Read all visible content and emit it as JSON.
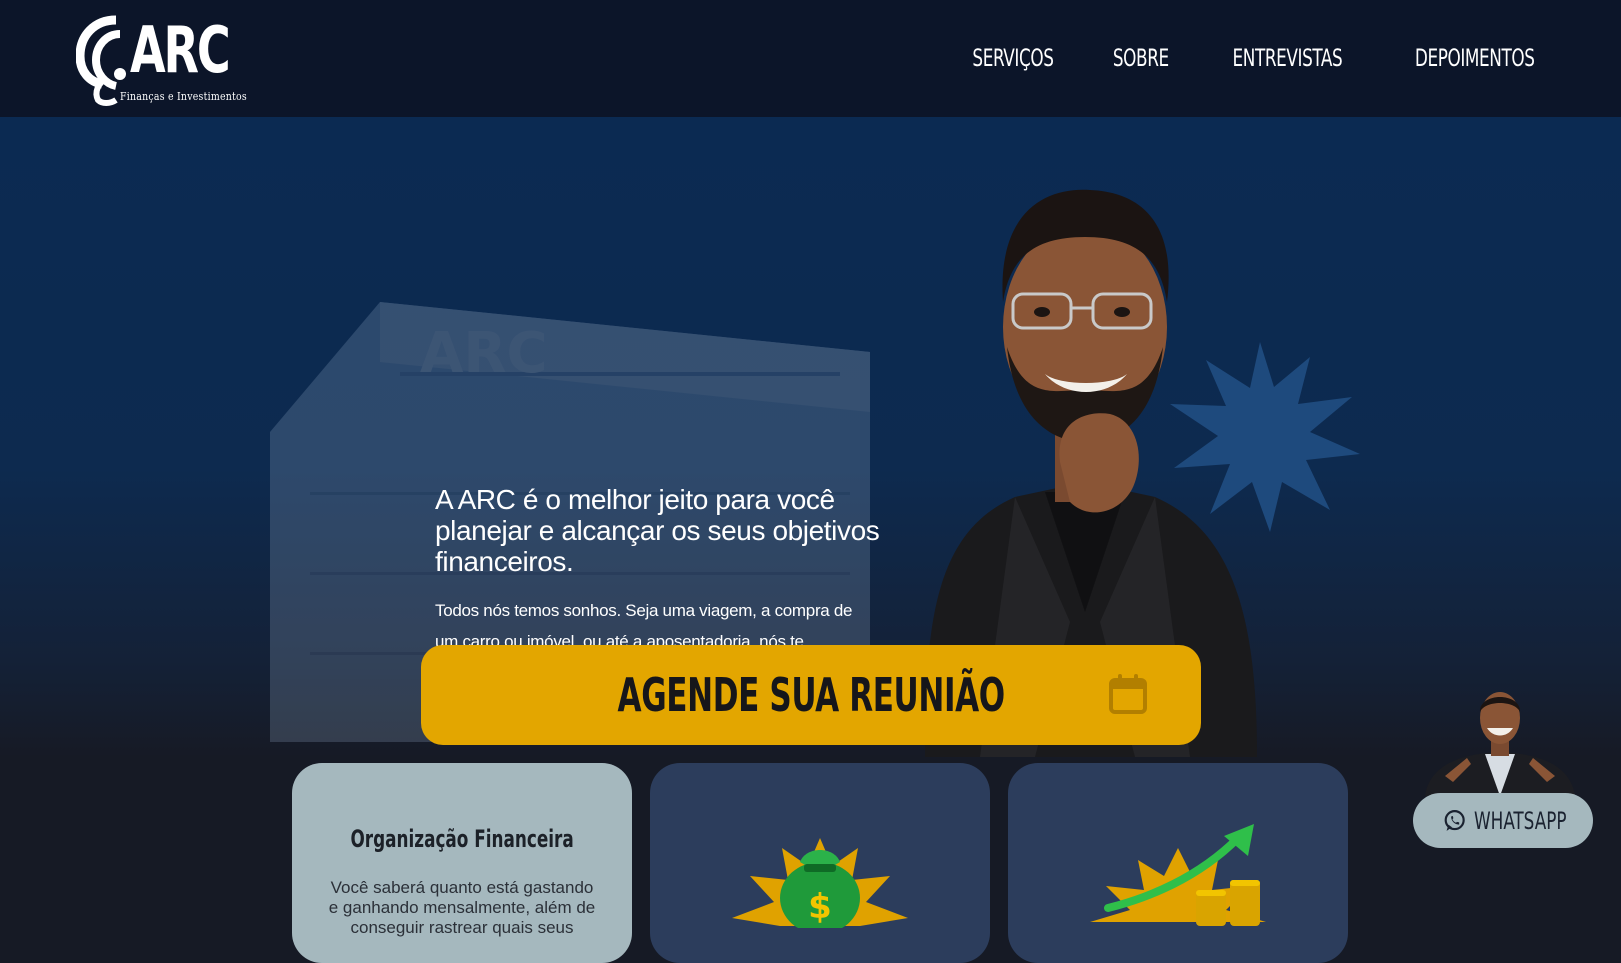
{
  "brand": {
    "name": "ARC",
    "tagline": "Finanças e Investimentos",
    "logo_icon": "arc-monogram-icon"
  },
  "nav": {
    "items": [
      {
        "label": "SERVIÇOS"
      },
      {
        "label": "SOBRE"
      },
      {
        "label": "ENTREVISTAS"
      },
      {
        "label": "DEPOIMENTOS"
      }
    ]
  },
  "hero": {
    "headline": "A ARC é o melhor jeito para você planejar e alcançar os seus objetivos financeiros.",
    "body": "Todos nós temos sonhos. Seja uma viagem, a compra de um carro ou imóvel, ou até a aposentadoria, nós te ajudamos a conquistar cada um deles. Através de um acompanhamento online, vamos juntos melhorando e aprimorando as suas finanças e investimentos.",
    "background_building_sign": "ARC"
  },
  "cta": {
    "label": "AGENDE SUA REUNIÃO",
    "icon": "calendar-icon"
  },
  "cards": [
    {
      "title": "Organização Financeira",
      "text": "Você saberá quanto está gastando e ganhando mensalmente, além de conseguir rastrear quais seus",
      "illustration": "money-bag-icon"
    },
    {
      "title": "",
      "text": "",
      "illustration": "money-bag-icon"
    },
    {
      "title": "",
      "text": "",
      "illustration": "growth-arrow-coins-icon"
    }
  ],
  "whatsapp": {
    "label": "WHATSAPP",
    "icon": "whatsapp-icon"
  },
  "colors": {
    "header_bg": "#0c1529",
    "hero_bg": "#0b2a52",
    "accent": "#e3a600",
    "card_light": "#a5b8be",
    "card_dark": "#2c3d5c"
  }
}
